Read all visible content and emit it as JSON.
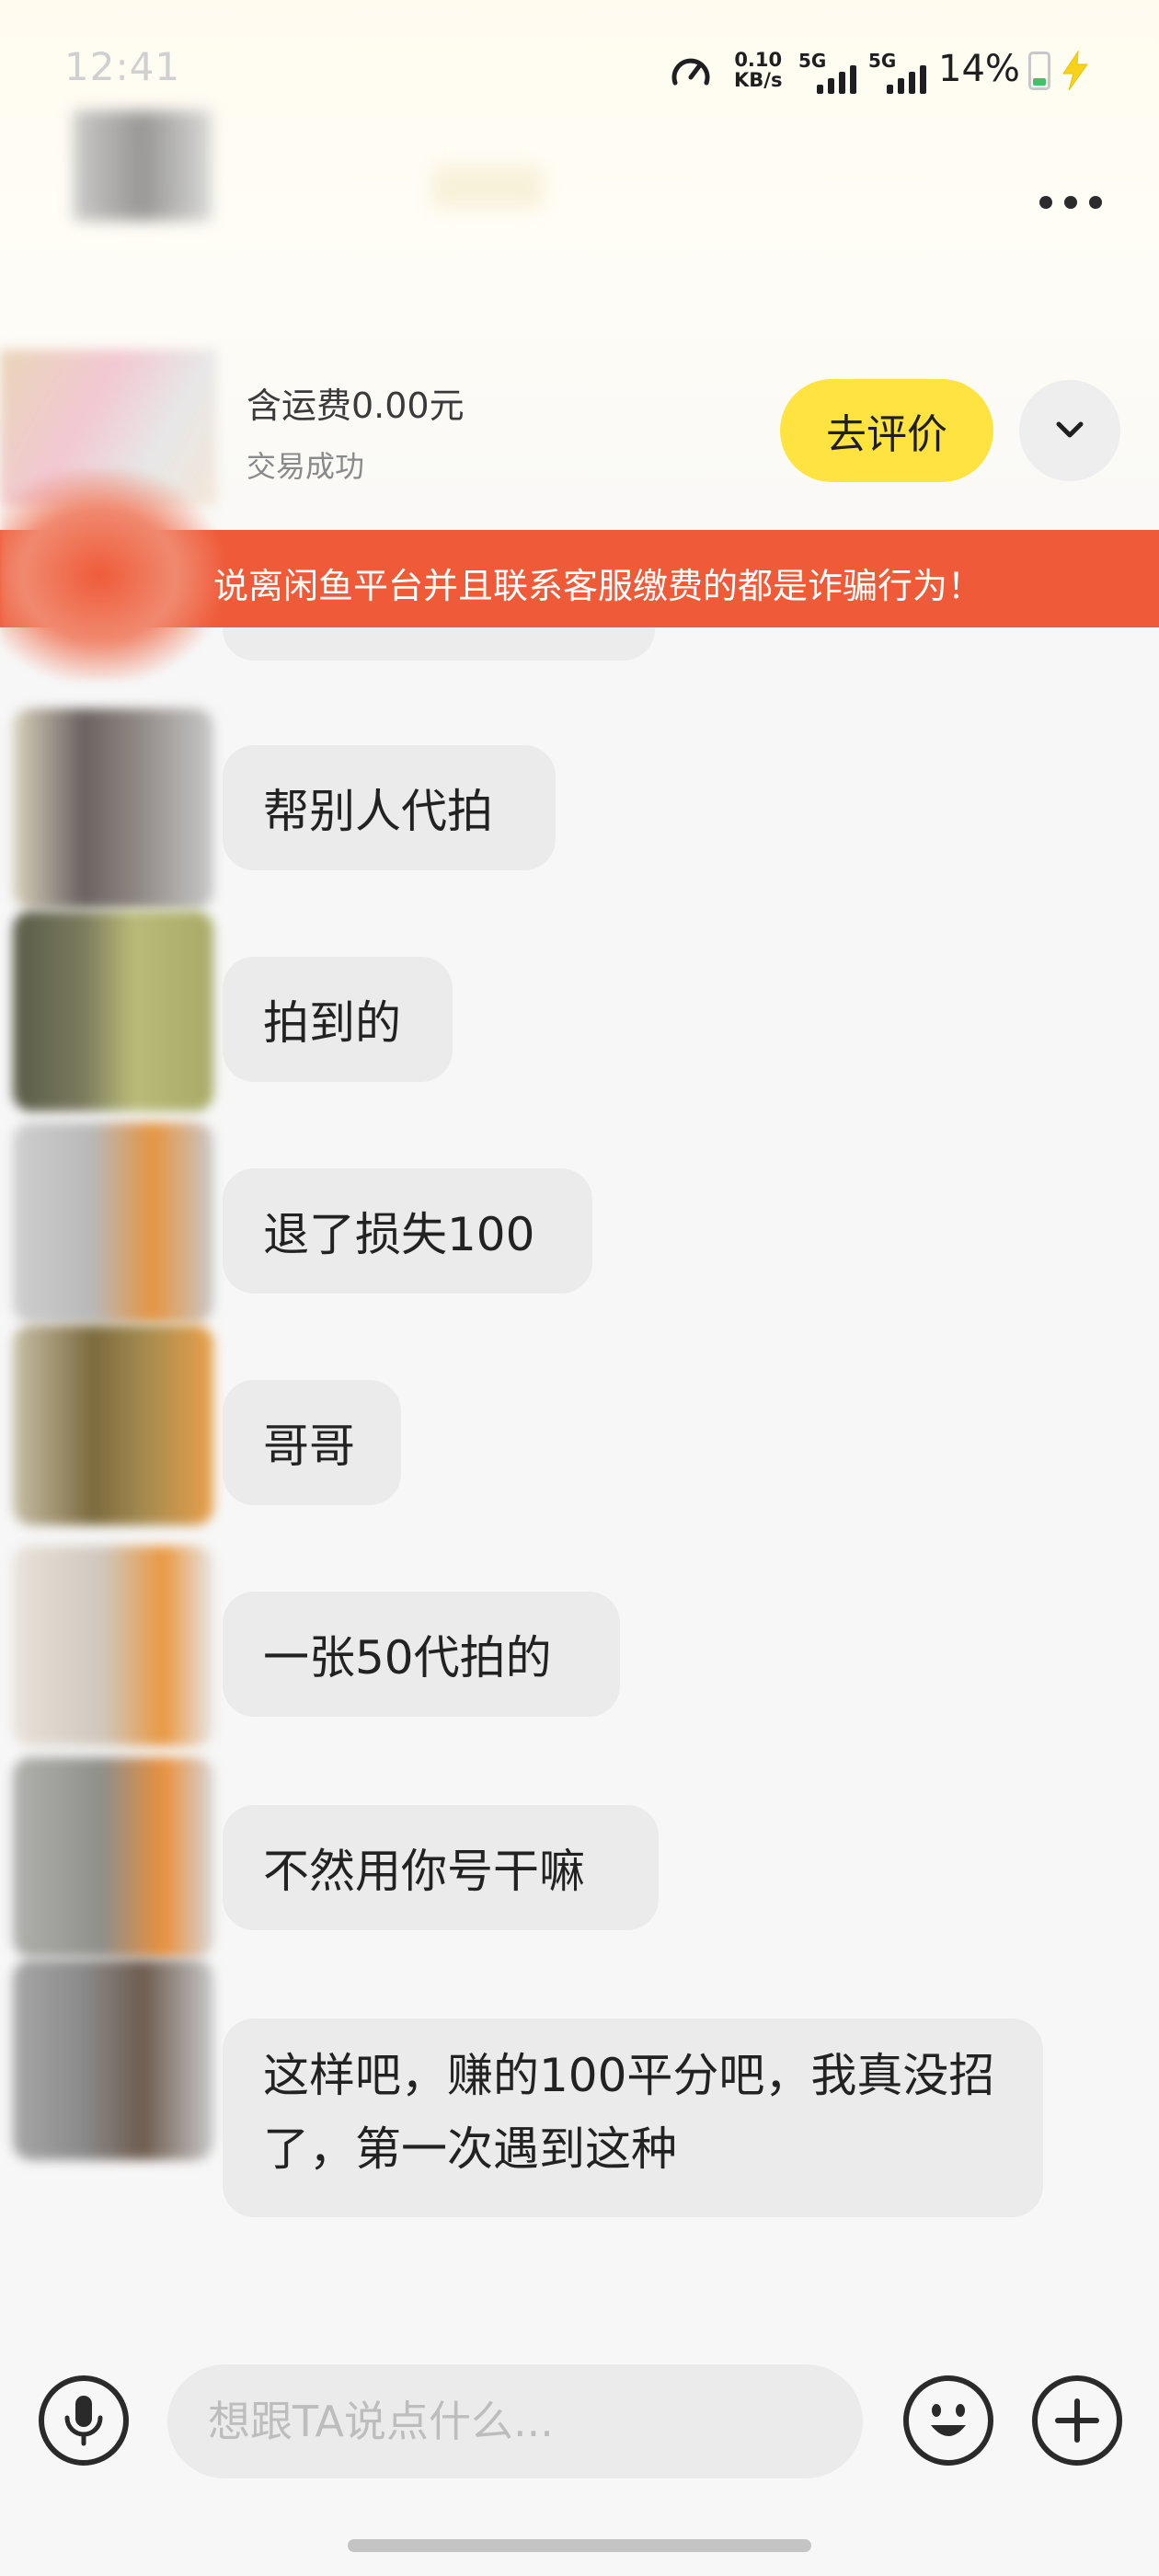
{
  "status_bar": {
    "time": "12:41",
    "net_speed_value": "0.10",
    "net_speed_unit": "KB/s",
    "sim1": "5G",
    "sim2": "5G",
    "battery": "14%"
  },
  "order": {
    "shipping_fee": "含运费0.00元",
    "status": "交易成功",
    "rate_button": "去评价"
  },
  "warning": {
    "text": "说离闲鱼平台并且联系客服缴费的都是诈骗行为！"
  },
  "messages": [
    {
      "text": "帮别人代拍"
    },
    {
      "text": "拍到的"
    },
    {
      "text": "退了损失100"
    },
    {
      "text": "哥哥"
    },
    {
      "text": "一张50代拍的"
    },
    {
      "text": "不然用你号干嘛"
    },
    {
      "text": "这样吧，赚的100平分吧，我真没招了，第一次遇到这种"
    }
  ],
  "input": {
    "placeholder": "想跟TA说点什么..."
  },
  "colors": {
    "accent_yellow": "#ffe341",
    "warning_red": "#ef5b39",
    "bubble_gray": "#ebebeb"
  }
}
